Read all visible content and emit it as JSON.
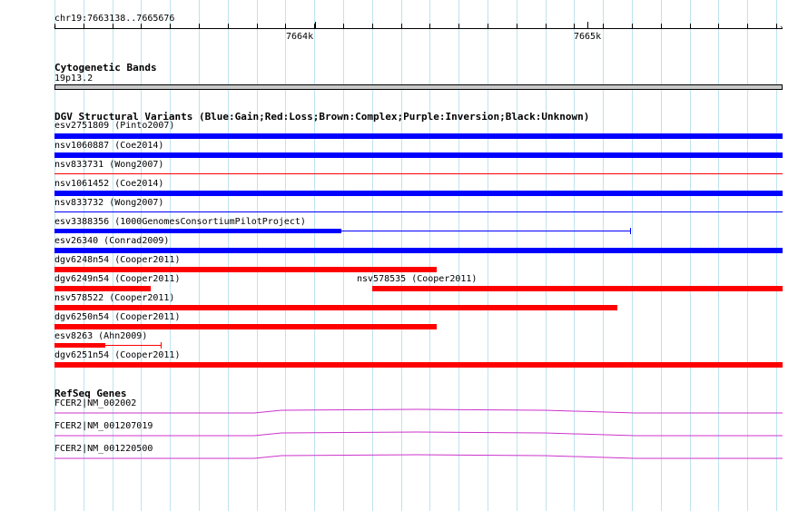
{
  "ruler": {
    "chrom_range": "chr19:7663138..7665676",
    "ticks": [
      "7664k",
      "7665k"
    ]
  },
  "cytoband": {
    "title": "Cytogenetic Bands",
    "band": "19p13.2"
  },
  "dgv": {
    "title": "DGV Structural Variants (Blue:Gain;Red:Loss;Brown:Complex;Purple:Inversion;Black:Unknown)",
    "colors": {
      "gain": "#0000ff",
      "loss": "#ff0000"
    },
    "items": [
      {
        "label": "esv2751809 (Pinto2007)",
        "type": "gain",
        "style": "thick",
        "start": 7663138,
        "end": 7665676
      },
      {
        "label": "nsv1060887 (Coe2014)",
        "type": "gain",
        "style": "thick",
        "start": 7663138,
        "end": 7665676
      },
      {
        "label": "nsv833731 (Wong2007)",
        "type": "loss",
        "style": "thin",
        "start": 7663138,
        "end": 7665676
      },
      {
        "label": "nsv1061452 (Coe2014)",
        "type": "gain",
        "style": "thick",
        "start": 7663138,
        "end": 7665676
      },
      {
        "label": "nsv833732 (Wong2007)",
        "type": "gain",
        "style": "thin",
        "start": 7663138,
        "end": 7665676
      },
      {
        "label": "esv3388356 (1000GenomesConsortiumPilotProject)",
        "type": "gain",
        "style": "split",
        "start": 7663138,
        "end": 7665149,
        "thick_end": 7664137
      },
      {
        "label": "esv26340 (Conrad2009)",
        "type": "gain",
        "style": "thick",
        "start": 7663138,
        "end": 7665676
      },
      {
        "label": "dgv6248n54 (Cooper2011)",
        "type": "loss",
        "style": "thick",
        "start": 7663138,
        "end": 7664470
      },
      {
        "label": "dgv6249n54 (Cooper2011)",
        "type": "loss",
        "style": "thick",
        "start": 7663138,
        "end": 7663473
      },
      {
        "label": "nsv578535 (Cooper2011)",
        "type": "loss",
        "style": "thick",
        "start": 7664245,
        "end": 7665676
      },
      {
        "label": "nsv578522 (Cooper2011)",
        "type": "loss",
        "style": "thick",
        "start": 7663138,
        "end": 7665100
      },
      {
        "label": "dgv6250n54 (Cooper2011)",
        "type": "loss",
        "style": "thick",
        "start": 7663138,
        "end": 7664470
      },
      {
        "label": "esv8263 (Ahn2009)",
        "type": "loss",
        "style": "split",
        "start": 7663138,
        "end": 7663510,
        "thick_end": 7663315
      },
      {
        "label": "dgv6251n54 (Cooper2011)",
        "type": "loss",
        "style": "thick",
        "start": 7663138,
        "end": 7665676
      }
    ]
  },
  "refseq": {
    "title": "RefSeq Genes",
    "color": "#cc33cc",
    "genes": [
      {
        "label": "FCER2|NM_002002"
      },
      {
        "label": "FCER2|NM_001207019"
      },
      {
        "label": "FCER2|NM_001220500"
      }
    ]
  }
}
